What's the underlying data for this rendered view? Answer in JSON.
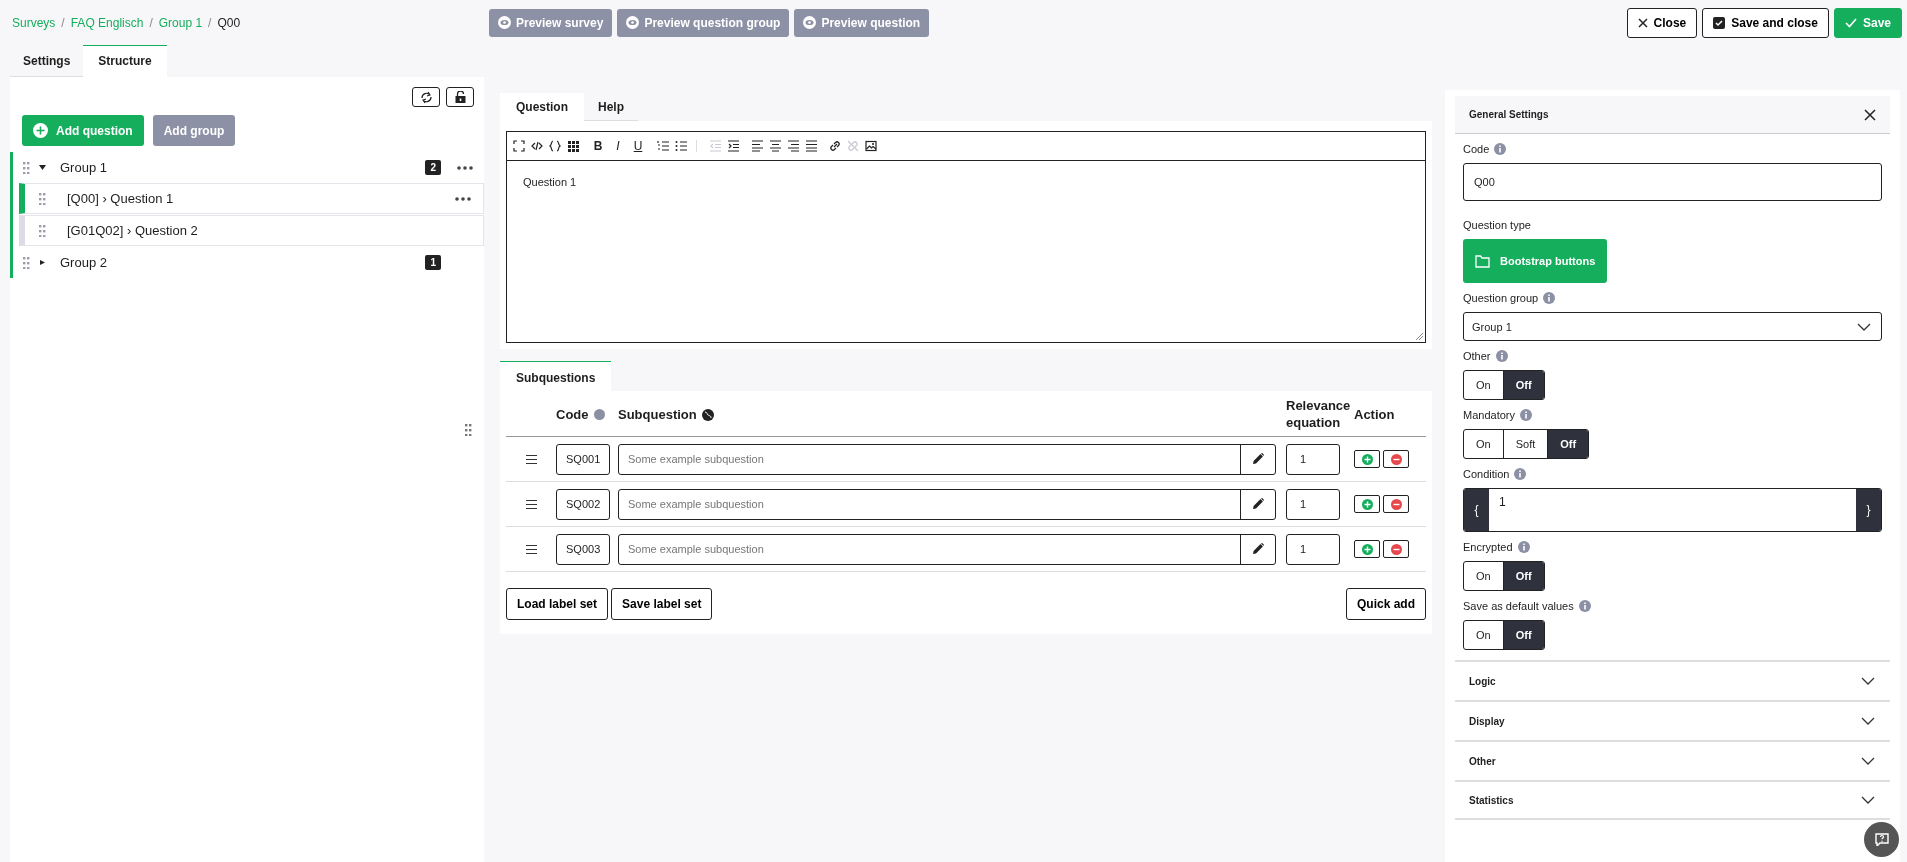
{
  "breadcrumb": [
    {
      "kind": "link",
      "label": "Surveys"
    },
    {
      "kind": "separator",
      "label": "/"
    },
    {
      "kind": "link",
      "label": "FAQ Englisch"
    },
    {
      "kind": "separator",
      "label": "/"
    },
    {
      "kind": "link",
      "label": "Group 1"
    },
    {
      "kind": "separator",
      "label": "/"
    },
    {
      "kind": "current",
      "label": "Q00"
    }
  ],
  "preview_buttons": [
    "Preview survey",
    "Preview question group",
    "Preview question"
  ],
  "actions": [
    {
      "label": "Close",
      "kind": "close"
    },
    {
      "label": "Save and close",
      "kind": "save-close"
    },
    {
      "label": "Save",
      "kind": "save"
    }
  ],
  "side_tabs": [
    {
      "label": "Settings",
      "selected": false
    },
    {
      "label": "Structure",
      "selected": true
    }
  ],
  "structure": {
    "add_question": "Add question",
    "add_group": "Add group",
    "groups": [
      {
        "label": "Group 1",
        "expanded": true,
        "count": "2",
        "children": [
          {
            "label": "[Q00] › Question 1",
            "selected": true
          },
          {
            "label": "[G01Q02] › Question 2",
            "selected": false
          }
        ]
      },
      {
        "label": "Group 2",
        "expanded": false,
        "count": "1"
      }
    ]
  },
  "editor": {
    "tabs": [
      {
        "label": "Question",
        "selected": true
      },
      {
        "label": "Help",
        "selected": false
      }
    ],
    "toolbar": [
      [
        {
          "kind": "fullscreen",
          "disabled": false
        },
        {
          "kind": "source",
          "disabled": false
        },
        {
          "kind": "braces",
          "disabled": false
        },
        {
          "kind": "grid",
          "disabled": false
        }
      ],
      [
        {
          "kind": "bold",
          "glyph": "B",
          "disabled": false
        },
        {
          "kind": "italic",
          "glyph": "I",
          "disabled": false
        },
        {
          "kind": "underline",
          "glyph": "U",
          "disabled": false
        }
      ],
      [
        {
          "kind": "numbered-list",
          "disabled": false
        },
        {
          "kind": "bullet-list",
          "disabled": false
        }
      ],
      [
        {
          "kind": "outdent",
          "disabled": true
        },
        {
          "kind": "indent",
          "disabled": false
        }
      ],
      [
        {
          "kind": "align-left",
          "disabled": false
        },
        {
          "kind": "align-center",
          "disabled": false
        },
        {
          "kind": "align-right",
          "disabled": false
        },
        {
          "kind": "align-justify",
          "disabled": false
        }
      ],
      [
        {
          "kind": "link",
          "disabled": false
        },
        {
          "kind": "unlink",
          "disabled": true
        },
        {
          "kind": "image",
          "disabled": false
        }
      ]
    ],
    "content": "Question 1"
  },
  "subquestions": {
    "tab": "Subquestions",
    "columns": [
      "Code",
      "Subquestion",
      "Relevance equation",
      "Action"
    ],
    "rows": [
      {
        "code": "SQ001",
        "placeholder": "Some example subquestion",
        "relevance": "1"
      },
      {
        "code": "SQ002",
        "placeholder": "Some example subquestion",
        "relevance": "1"
      },
      {
        "code": "SQ003",
        "placeholder": "Some example subquestion",
        "relevance": "1"
      }
    ],
    "buttons": [
      "Load label set",
      "Save label set"
    ],
    "quick_add": "Quick add"
  },
  "settings": {
    "title": "General Settings",
    "fields": [
      {
        "kind": "input",
        "label": "Code",
        "info": true,
        "value": "Q00"
      },
      {
        "kind": "type-button",
        "label": "Question type",
        "info": false,
        "value": "Bootstrap buttons"
      },
      {
        "kind": "select",
        "label": "Question group",
        "info": true,
        "value": "Group 1"
      },
      {
        "kind": "toggle",
        "label": "Other",
        "info": true,
        "options": [
          {
            "label": "On",
            "selected": false
          },
          {
            "label": "Off",
            "selected": true
          }
        ]
      },
      {
        "kind": "toggle",
        "label": "Mandatory",
        "info": true,
        "options": [
          {
            "label": "On",
            "selected": false
          },
          {
            "label": "Soft",
            "selected": false
          },
          {
            "label": "Off",
            "selected": true
          }
        ]
      },
      {
        "kind": "condition",
        "label": "Condition",
        "info": true,
        "open": "{",
        "value": "1",
        "close": "}"
      },
      {
        "kind": "toggle",
        "label": "Encrypted",
        "info": true,
        "options": [
          {
            "label": "On",
            "selected": false
          },
          {
            "label": "Off",
            "selected": true
          }
        ]
      },
      {
        "kind": "toggle",
        "label": "Save as default values",
        "info": true,
        "options": [
          {
            "label": "On",
            "selected": false
          },
          {
            "label": "Off",
            "selected": true
          }
        ]
      }
    ],
    "sections": [
      {
        "label": "Logic",
        "expanded": false
      },
      {
        "label": "Display",
        "expanded": false
      },
      {
        "label": "Other",
        "expanded": false
      },
      {
        "label": "Statistics",
        "expanded": false
      }
    ]
  }
}
